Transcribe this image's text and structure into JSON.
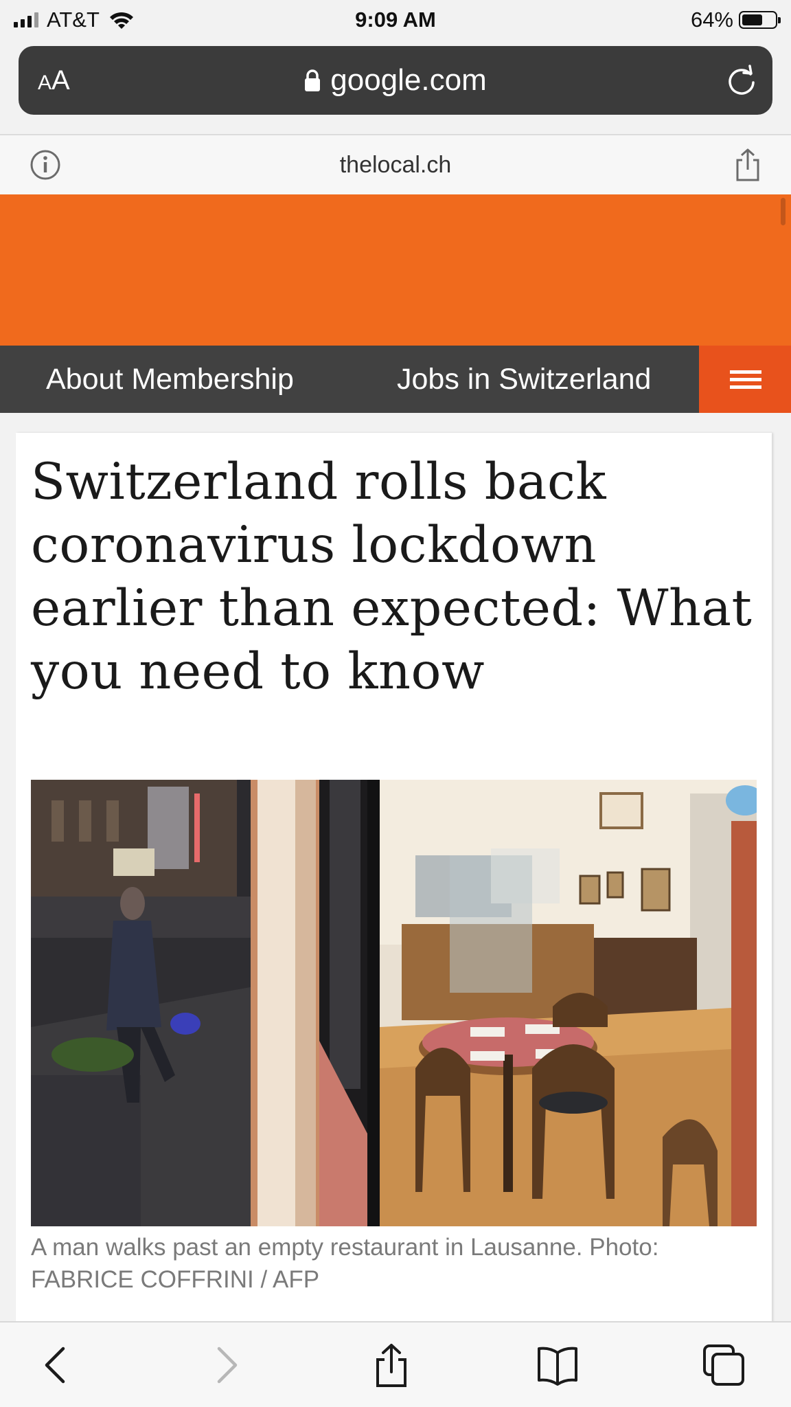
{
  "status_bar": {
    "carrier": "AT&T",
    "time": "9:09 AM",
    "battery_percent": "64%",
    "battery_level": 0.64,
    "signal_bars": 3
  },
  "browser": {
    "aa_small": "A",
    "aa_large": "A",
    "url": "google.com",
    "site_domain": "thelocal.ch"
  },
  "nav": {
    "membership": "About Membership",
    "jobs": "Jobs in Switzerland"
  },
  "article": {
    "headline": "Switzerland rolls back coronavirus lockdown earlier than expected: What you need to know",
    "photo_caption": "A man walks past an empty restaurant in Lausanne. Photo: FABRICE COFFRINI / AFP"
  },
  "colors": {
    "header_orange": "#f06a1d",
    "nav_dark": "#414141",
    "menu_red": "#e8521c"
  },
  "icons": {
    "info": "info-icon",
    "share": "share-icon",
    "lock": "lock-icon",
    "reload": "reload-icon",
    "menu": "hamburger-menu-icon",
    "back": "chevron-left-icon",
    "forward": "chevron-right-icon",
    "bookmarks": "book-icon",
    "tabs": "tabs-icon"
  }
}
